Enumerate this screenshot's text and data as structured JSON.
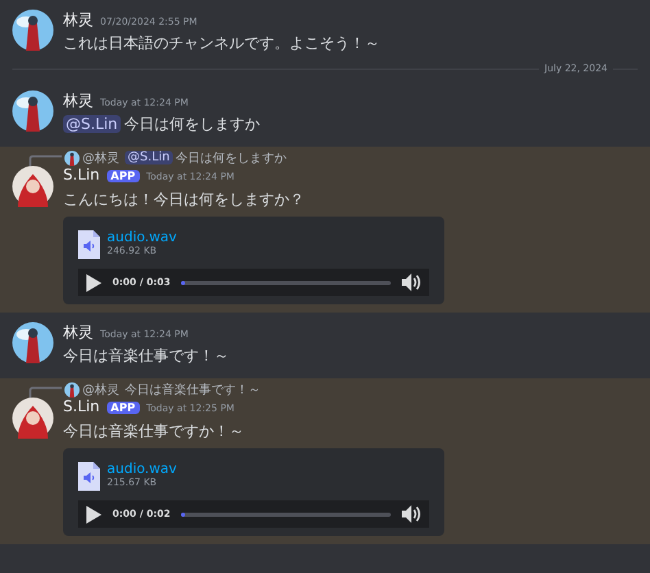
{
  "messages": [
    {
      "kind": "user",
      "highlighted": false,
      "author": "林灵",
      "timestamp": "07/20/2024 2:55 PM",
      "content": [
        {
          "kind": "text",
          "text": "これは日本語のチャンネルです。よこそう！～"
        }
      ]
    },
    {
      "kind": "divider",
      "label": "July 22, 2024"
    },
    {
      "kind": "user",
      "highlighted": false,
      "author": "林灵",
      "timestamp": "Today at 12:24 PM",
      "content": [
        {
          "kind": "mention",
          "text": "@S.Lin"
        },
        {
          "kind": "text",
          "text": "今日は何をしますか"
        }
      ]
    },
    {
      "kind": "bot",
      "highlighted": true,
      "reply": {
        "author": "@林灵",
        "content": [
          {
            "kind": "mention",
            "text": "@S.Lin"
          },
          {
            "kind": "text",
            "text": "今日は何をしますか"
          }
        ]
      },
      "author": "S.Lin",
      "badge": "APP",
      "timestamp": "Today at 12:24 PM",
      "content": [
        {
          "kind": "text",
          "text": "こんにちは！今日は何をしますか？"
        }
      ],
      "attachment": {
        "filename": "audio.wav",
        "size": "246.92 KB",
        "time": "0:00 / 0:03",
        "level": 0.02
      }
    },
    {
      "kind": "user",
      "highlighted": false,
      "author": "林灵",
      "timestamp": "Today at 12:24 PM",
      "content": [
        {
          "kind": "text",
          "text": "今日は音楽仕事です！～"
        }
      ]
    },
    {
      "kind": "bot",
      "highlighted": true,
      "reply": {
        "author": "@林灵",
        "content": [
          {
            "kind": "text",
            "text": "今日は音楽仕事です！～"
          }
        ]
      },
      "author": "S.Lin",
      "badge": "APP",
      "timestamp": "Today at 12:25 PM",
      "content": [
        {
          "kind": "text",
          "text": "今日は音楽仕事ですか！～"
        }
      ],
      "attachment": {
        "filename": "audio.wav",
        "size": "215.67 KB",
        "time": "0:00 / 0:02",
        "level": 0.02
      }
    }
  ]
}
